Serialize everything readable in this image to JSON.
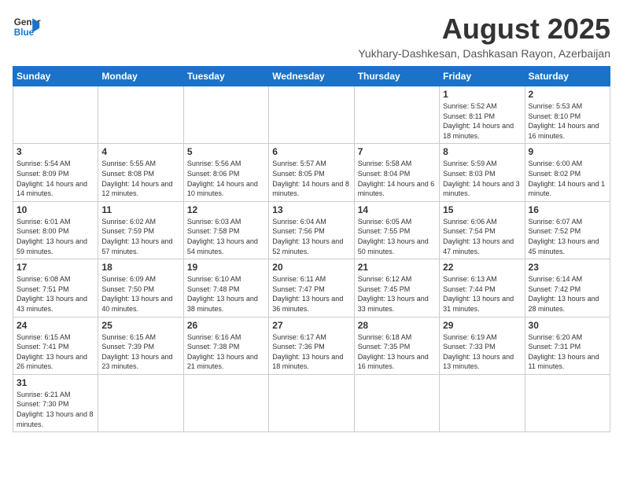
{
  "header": {
    "logo_line1": "General",
    "logo_line2": "Blue",
    "title": "August 2025",
    "subtitle": "Yukhary-Dashkesan, Dashkasan Rayon, Azerbaijan"
  },
  "weekdays": [
    "Sunday",
    "Monday",
    "Tuesday",
    "Wednesday",
    "Thursday",
    "Friday",
    "Saturday"
  ],
  "weeks": [
    [
      {
        "day": "",
        "info": ""
      },
      {
        "day": "",
        "info": ""
      },
      {
        "day": "",
        "info": ""
      },
      {
        "day": "",
        "info": ""
      },
      {
        "day": "",
        "info": ""
      },
      {
        "day": "1",
        "info": "Sunrise: 5:52 AM\nSunset: 8:11 PM\nDaylight: 14 hours and 18 minutes."
      },
      {
        "day": "2",
        "info": "Sunrise: 5:53 AM\nSunset: 8:10 PM\nDaylight: 14 hours and 16 minutes."
      }
    ],
    [
      {
        "day": "3",
        "info": "Sunrise: 5:54 AM\nSunset: 8:09 PM\nDaylight: 14 hours and 14 minutes."
      },
      {
        "day": "4",
        "info": "Sunrise: 5:55 AM\nSunset: 8:08 PM\nDaylight: 14 hours and 12 minutes."
      },
      {
        "day": "5",
        "info": "Sunrise: 5:56 AM\nSunset: 8:06 PM\nDaylight: 14 hours and 10 minutes."
      },
      {
        "day": "6",
        "info": "Sunrise: 5:57 AM\nSunset: 8:05 PM\nDaylight: 14 hours and 8 minutes."
      },
      {
        "day": "7",
        "info": "Sunrise: 5:58 AM\nSunset: 8:04 PM\nDaylight: 14 hours and 6 minutes."
      },
      {
        "day": "8",
        "info": "Sunrise: 5:59 AM\nSunset: 8:03 PM\nDaylight: 14 hours and 3 minutes."
      },
      {
        "day": "9",
        "info": "Sunrise: 6:00 AM\nSunset: 8:02 PM\nDaylight: 14 hours and 1 minute."
      }
    ],
    [
      {
        "day": "10",
        "info": "Sunrise: 6:01 AM\nSunset: 8:00 PM\nDaylight: 13 hours and 59 minutes."
      },
      {
        "day": "11",
        "info": "Sunrise: 6:02 AM\nSunset: 7:59 PM\nDaylight: 13 hours and 57 minutes."
      },
      {
        "day": "12",
        "info": "Sunrise: 6:03 AM\nSunset: 7:58 PM\nDaylight: 13 hours and 54 minutes."
      },
      {
        "day": "13",
        "info": "Sunrise: 6:04 AM\nSunset: 7:56 PM\nDaylight: 13 hours and 52 minutes."
      },
      {
        "day": "14",
        "info": "Sunrise: 6:05 AM\nSunset: 7:55 PM\nDaylight: 13 hours and 50 minutes."
      },
      {
        "day": "15",
        "info": "Sunrise: 6:06 AM\nSunset: 7:54 PM\nDaylight: 13 hours and 47 minutes."
      },
      {
        "day": "16",
        "info": "Sunrise: 6:07 AM\nSunset: 7:52 PM\nDaylight: 13 hours and 45 minutes."
      }
    ],
    [
      {
        "day": "17",
        "info": "Sunrise: 6:08 AM\nSunset: 7:51 PM\nDaylight: 13 hours and 43 minutes."
      },
      {
        "day": "18",
        "info": "Sunrise: 6:09 AM\nSunset: 7:50 PM\nDaylight: 13 hours and 40 minutes."
      },
      {
        "day": "19",
        "info": "Sunrise: 6:10 AM\nSunset: 7:48 PM\nDaylight: 13 hours and 38 minutes."
      },
      {
        "day": "20",
        "info": "Sunrise: 6:11 AM\nSunset: 7:47 PM\nDaylight: 13 hours and 36 minutes."
      },
      {
        "day": "21",
        "info": "Sunrise: 6:12 AM\nSunset: 7:45 PM\nDaylight: 13 hours and 33 minutes."
      },
      {
        "day": "22",
        "info": "Sunrise: 6:13 AM\nSunset: 7:44 PM\nDaylight: 13 hours and 31 minutes."
      },
      {
        "day": "23",
        "info": "Sunrise: 6:14 AM\nSunset: 7:42 PM\nDaylight: 13 hours and 28 minutes."
      }
    ],
    [
      {
        "day": "24",
        "info": "Sunrise: 6:15 AM\nSunset: 7:41 PM\nDaylight: 13 hours and 26 minutes."
      },
      {
        "day": "25",
        "info": "Sunrise: 6:15 AM\nSunset: 7:39 PM\nDaylight: 13 hours and 23 minutes."
      },
      {
        "day": "26",
        "info": "Sunrise: 6:16 AM\nSunset: 7:38 PM\nDaylight: 13 hours and 21 minutes."
      },
      {
        "day": "27",
        "info": "Sunrise: 6:17 AM\nSunset: 7:36 PM\nDaylight: 13 hours and 18 minutes."
      },
      {
        "day": "28",
        "info": "Sunrise: 6:18 AM\nSunset: 7:35 PM\nDaylight: 13 hours and 16 minutes."
      },
      {
        "day": "29",
        "info": "Sunrise: 6:19 AM\nSunset: 7:33 PM\nDaylight: 13 hours and 13 minutes."
      },
      {
        "day": "30",
        "info": "Sunrise: 6:20 AM\nSunset: 7:31 PM\nDaylight: 13 hours and 11 minutes."
      }
    ],
    [
      {
        "day": "31",
        "info": "Sunrise: 6:21 AM\nSunset: 7:30 PM\nDaylight: 13 hours and 8 minutes."
      },
      {
        "day": "",
        "info": ""
      },
      {
        "day": "",
        "info": ""
      },
      {
        "day": "",
        "info": ""
      },
      {
        "day": "",
        "info": ""
      },
      {
        "day": "",
        "info": ""
      },
      {
        "day": "",
        "info": ""
      }
    ]
  ]
}
